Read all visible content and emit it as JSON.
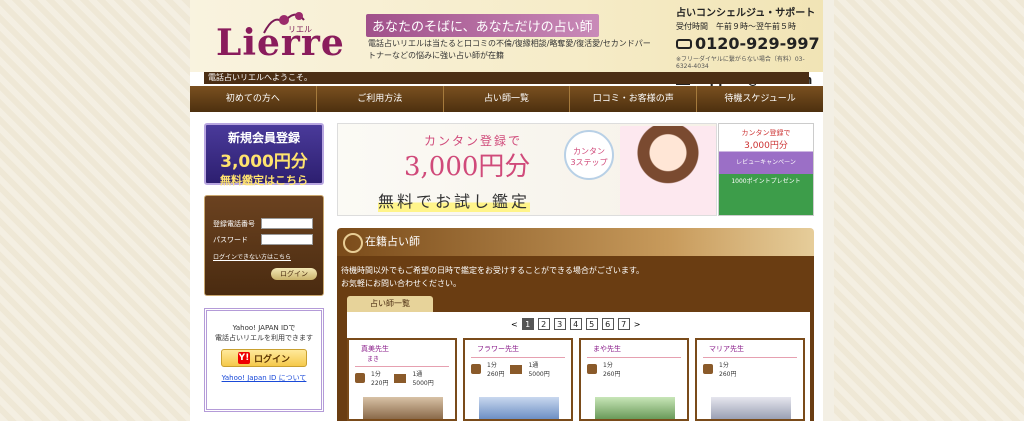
{
  "header": {
    "logo": "Lierre",
    "logo_kana": "リエル",
    "tagline": "あなたのそばに、あなただけの占い師",
    "description": "電話占いリエルは当たると口コミの不倫/復縁相談/略奪愛/復活愛/セカンドパートナーなどの悩みに強い占い師が在籍",
    "support_title": "占いコンシェルジュ・サポート",
    "support_hours": "受付時間　午前９時〜翌午前５時",
    "phone": "0120-929-997",
    "phone_note": "※フリーダイヤルに繋がらない場合（有料）03-6324-4034",
    "email": "support@lierre.in",
    "welcome": "電話占いリエルへようこそ。"
  },
  "nav": {
    "items": [
      "初めての方へ",
      "ご利用方法",
      "占い師一覧",
      "口コミ・お客様の声",
      "待機スケジュール"
    ]
  },
  "sidebar": {
    "register_title": "新規会員登録",
    "register_amount": "3,000円分",
    "register_sub": "無料鑑定はこちら",
    "login_phone_label": "登録電話番号",
    "login_password_label": "パスワード",
    "forgot_link": "ログインできない方はこちら",
    "login_button": "ログイン",
    "yahoo_text_1": "Yahoo! JAPAN IDで",
    "yahoo_text_2": "電話占いリエルを利用できます",
    "yahoo_button": "ログイン",
    "yahoo_link": "Yahoo! Japan ID について"
  },
  "banner": {
    "top": "カンタン登録で",
    "amount": "3,000円分",
    "bottom": "無料でお試し鑑定",
    "bubble_1": "カンタン",
    "bubble_2": "3ステップ"
  },
  "side_banner": {
    "line1": "カンタン登録で",
    "amount": "3,000円分",
    "purple": "レビューキャンペーン",
    "green": "1000ポイントプレゼント"
  },
  "section": {
    "title": "在籍占い師",
    "text_1": "待機時間以外でもご希望の日時で鑑定をお受けすることができる場合がございます。",
    "text_2": "お気軽にお問い合わせください。",
    "tab": "占い師一覧",
    "pager_prev": "<",
    "pager_next": ">",
    "pages": [
      "1",
      "2",
      "3",
      "4",
      "5",
      "6",
      "7"
    ]
  },
  "cards": [
    {
      "name": "真美先生",
      "kana": "まき",
      "tel_unit": "1分",
      "tel_price": "220円",
      "mail_unit": "1通",
      "mail_price": "5000円"
    },
    {
      "name": "フラワー先生",
      "kana": "",
      "tel_unit": "1分",
      "tel_price": "260円",
      "mail_unit": "1通",
      "mail_price": "5000円"
    },
    {
      "name": "まや先生",
      "kana": "",
      "tel_unit": "1分",
      "tel_price": "260円",
      "mail_unit": "",
      "mail_price": ""
    },
    {
      "name": "マリア先生",
      "kana": "",
      "tel_unit": "1分",
      "tel_price": "260円",
      "mail_unit": "",
      "mail_price": ""
    }
  ],
  "colors": {
    "brand": "#8a1c5c",
    "nav": "#5a3714",
    "accent": "#d04a7a"
  }
}
